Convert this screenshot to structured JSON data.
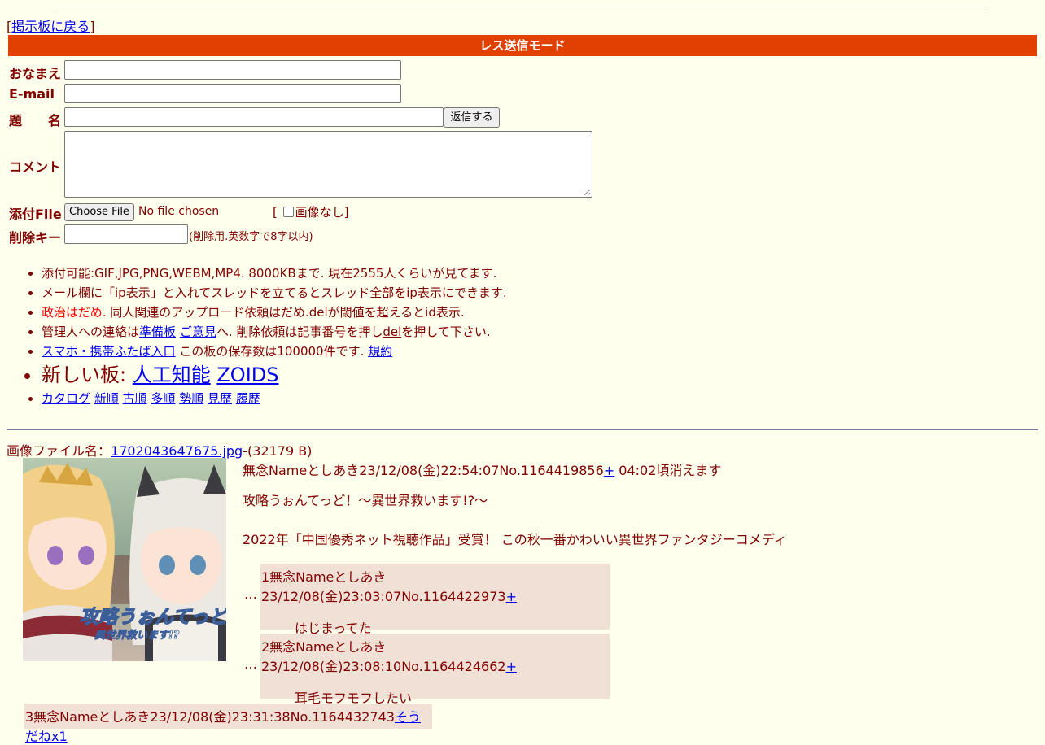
{
  "nav": {
    "back_prefix": "[",
    "back_label": "掲示板に戻る",
    "back_suffix": "]"
  },
  "mode_title": "レス送信モード",
  "form": {
    "name_label": "おなまえ",
    "email_label": "E-mail",
    "subject_label": "題　　名",
    "submit_label": "返信する",
    "comment_label": "コメント",
    "file_label": "添付File",
    "file_button": "Choose File",
    "file_status": "No file chosen",
    "noimage_prefix": "[",
    "noimage_label": "画像なし",
    "noimage_suffix": "]",
    "delkey_label": "削除キー",
    "delkey_note": "(削除用.英数字で8字以内)"
  },
  "rules": {
    "r1": "添付可能:GIF,JPG,PNG,WEBM,MP4. 8000KBまで. 現在2555人くらいが見てます.",
    "r2": "メール欄に「ip表示」と入れてスレッドを立てるとスレッド全部をip表示にできます.",
    "r3_red": "政治はだめ.",
    "r3_rest": " 同人関連のアップロード依頼はだめ.delが閾値を超えるとid表示.",
    "r4_a": "管理人への連絡は",
    "r4_link1": "準備板",
    "r4_link2": "ご意見",
    "r4_b": "へ. 削除依頼は記事番号を押し",
    "r4_link3": "del",
    "r4_c": "を押して下さい.",
    "r5_link": "スマホ・携帯ふたば入口",
    "r5_text": " この板の保存数は100000件です.",
    "r5_link2": "規約",
    "r6_text": "新しい板: ",
    "r6_link1": "人工知能",
    "r6_link2": "ZOIDS",
    "r7_links": [
      "カタログ",
      "新順",
      "古順",
      "多順",
      "勢順",
      "見歴",
      "履歴"
    ]
  },
  "file": {
    "prefix": "画像ファイル名：",
    "name": "1702043647675.jpg",
    "size": "-(32179 B)"
  },
  "thumb": {
    "title_line1": "攻略うぉんてっど！",
    "title_line2": "異世界救います!?"
  },
  "op": {
    "header": "無念Nameとしあき23/12/08(金)22:54:07No.1164419856",
    "plus": "+",
    "expire": " 04:02頃消えます",
    "line1": "攻略うぉんてっど！〜異世界救います!?〜",
    "line2": "2022年「中国優秀ネット視聴作品」受賞！ この秋一番かわいい異世界ファンタジーコメディ"
  },
  "replies": [
    {
      "dots": "…",
      "header": "1無念Nameとしあき23/12/08(金)23:03:07No.1164422973",
      "plus": "+",
      "body": "はじまってた"
    },
    {
      "dots": "…",
      "header": "2無念Nameとしあき23/12/08(金)23:08:10No.1164424662",
      "plus": "+",
      "body": "耳毛モフモフしたい"
    },
    {
      "header": "3無念Nameとしあき23/12/08(金)23:31:38No.1164432743",
      "sodane": "そうだねx1"
    }
  ]
}
